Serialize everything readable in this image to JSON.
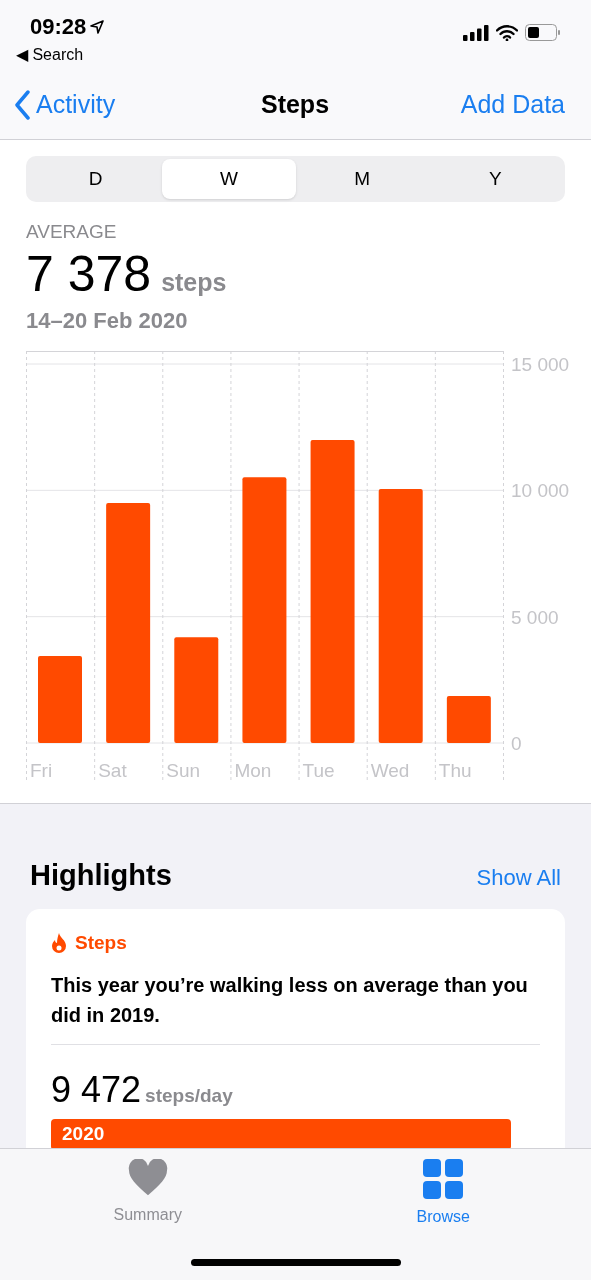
{
  "status_bar": {
    "time": "09:28",
    "back_link": "◀ Search"
  },
  "nav": {
    "back": "Activity",
    "title": "Steps",
    "action": "Add Data"
  },
  "segments": [
    {
      "label": "D",
      "selected": false
    },
    {
      "label": "W",
      "selected": true
    },
    {
      "label": "M",
      "selected": false
    },
    {
      "label": "Y",
      "selected": false
    }
  ],
  "summary": {
    "label": "AVERAGE",
    "value": "7 378",
    "unit": "steps",
    "range": "14–20 Feb 2020"
  },
  "chart_data": {
    "type": "bar",
    "categories": [
      "Fri",
      "Sat",
      "Sun",
      "Mon",
      "Tue",
      "Wed",
      "Thu"
    ],
    "series": [
      {
        "color": "#ff4a00",
        "values": [
          3440,
          9500,
          4190,
          10520,
          11990,
          10050,
          1860
        ]
      }
    ],
    "ylim": [
      0,
      15000
    ],
    "yticks": [
      {
        "value": 0,
        "label": "0"
      },
      {
        "value": 5000,
        "label": "5 000"
      },
      {
        "value": 10000,
        "label": "10 000"
      },
      {
        "value": 15000,
        "label": "15 000"
      }
    ]
  },
  "highlights": {
    "title": "Highlights",
    "action": "Show All",
    "card": {
      "category": "Steps",
      "text": "This year you’re walking less on average than you did in 2019.",
      "value": "9 472",
      "unit": "steps/day",
      "bar": {
        "label": "2020"
      }
    }
  },
  "tab_bar": [
    {
      "label": "Summary",
      "selected": false
    },
    {
      "label": "Browse",
      "selected": true
    }
  ]
}
